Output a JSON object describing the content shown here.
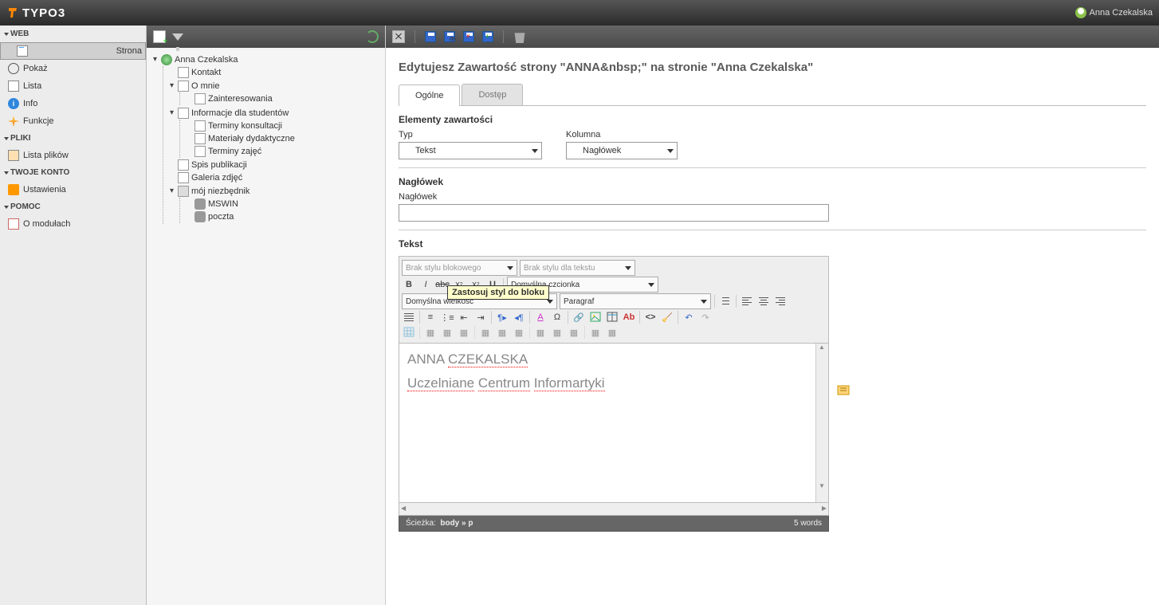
{
  "brand": "TYPO3",
  "user": {
    "name": "Anna Czekalska"
  },
  "nav": {
    "web": {
      "title": "WEB",
      "items": [
        {
          "label": "Strona",
          "sel": true
        },
        {
          "label": "Pokaż"
        },
        {
          "label": "Lista"
        },
        {
          "label": "Info"
        },
        {
          "label": "Funkcje"
        }
      ]
    },
    "pliki": {
      "title": "PLIKI",
      "items": [
        {
          "label": "Lista plików"
        }
      ]
    },
    "konto": {
      "title": "TWOJE KONTO",
      "items": [
        {
          "label": "Ustawienia"
        }
      ]
    },
    "pomoc": {
      "title": "POMOC",
      "items": [
        {
          "label": "O modułach"
        }
      ]
    }
  },
  "tree": {
    "root": "Anna Czekalska",
    "kontakt": "Kontakt",
    "omnie": "O mnie",
    "zaint": "Zainteresowania",
    "info": "Informacje dla studentów",
    "term_kon": "Terminy konsultacji",
    "mat": "Materiały dydaktyczne",
    "term_zaj": "Terminy zajęć",
    "spis": "Spis publikacji",
    "galeria": "Galeria zdjęć",
    "niezb": "mój niezbędnik",
    "mswin": "MSWIN",
    "poczta": "poczta"
  },
  "header_text": "Edytujesz Zawartość strony \"ANNA&nbsp;\" na stronie \"Anna Czekalska\"",
  "tabs": {
    "ogolne": "Ogólne",
    "dostep": "Dostęp"
  },
  "section_elem": {
    "title": "Elementy zawartości",
    "typ_label": "Typ",
    "typ_value": "Tekst",
    "kol_label": "Kolumna",
    "kol_value": "Nagłówek"
  },
  "section_head": {
    "title": "Nagłówek",
    "label": "Nagłówek",
    "value": ""
  },
  "section_text": {
    "title": "Tekst"
  },
  "rte": {
    "block_style": "Brak stylu blokowego",
    "text_style": "Brak stylu dla tekstu",
    "font": "Domyślna czcionka",
    "size": "Domyślna wielkość",
    "format": "Paragraf",
    "tooltip": "Zastosuj styl do bloku"
  },
  "editor_content": {
    "l1a": "ANNA",
    "l1b": "CZEKALSKA",
    "l2a": "Uczelniane",
    "l2b": "Centrum",
    "l2c": "Informartyki"
  },
  "status": {
    "path_label": "Ścieżka:",
    "path": "body » p",
    "words": "5 words"
  }
}
